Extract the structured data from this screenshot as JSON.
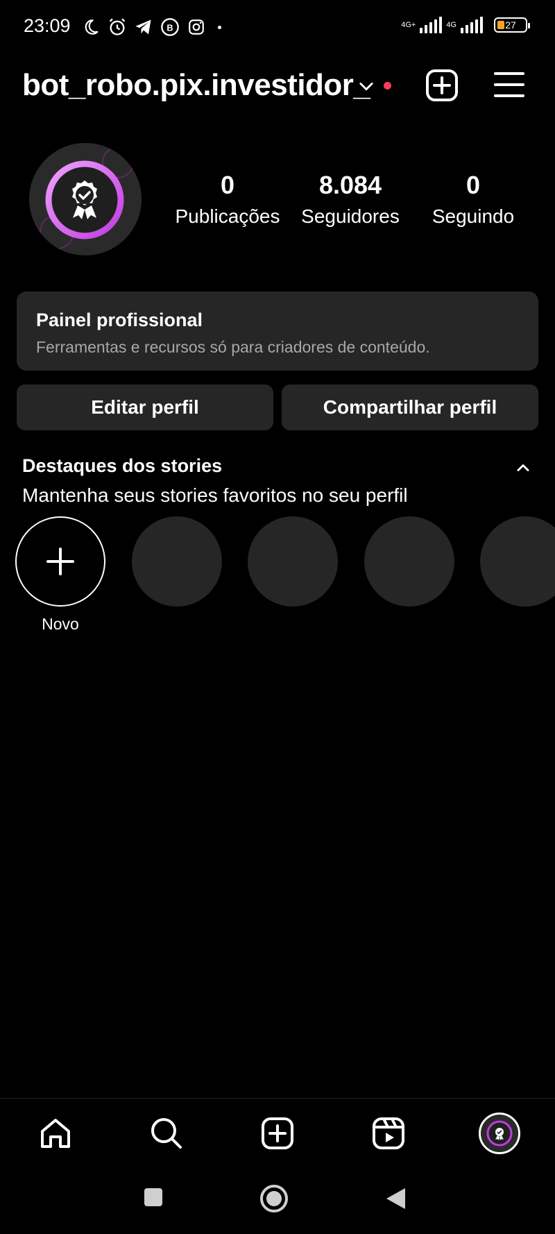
{
  "status_bar": {
    "time": "23:09",
    "icons": [
      "moon-icon",
      "alarm-icon",
      "telegram-icon",
      "whatsapp-business-icon",
      "instagram-icon"
    ],
    "network_1": "4G+",
    "network_2": "4G",
    "battery": "27"
  },
  "header": {
    "username": "bot_robo.pix.investidor_",
    "notification_color": "#ff3b5c"
  },
  "profile": {
    "stats": [
      {
        "value": "0",
        "label": "Publicações"
      },
      {
        "value": "8.084",
        "label": "Seguidores"
      },
      {
        "value": "0",
        "label": "Seguindo"
      }
    ]
  },
  "panel": {
    "title": "Painel profissional",
    "subtitle": "Ferramentas e recursos só para criadores de conteúdo."
  },
  "buttons": {
    "edit": "Editar perfil",
    "share": "Compartilhar perfil"
  },
  "highlights": {
    "title": "Destaques dos stories",
    "subtitle": "Mantenha seus stories favoritos no seu perfil",
    "new_label": "Novo",
    "placeholders": 4
  },
  "bottom_nav": {
    "items": [
      "home-icon",
      "search-icon",
      "create-icon",
      "reels-icon",
      "profile-avatar"
    ]
  },
  "colors": {
    "background": "#000000",
    "surface": "#262626",
    "accent_gradient": [
      "#c13be0",
      "#f0a0ff"
    ],
    "secondary_text": "#a8a8a8"
  }
}
